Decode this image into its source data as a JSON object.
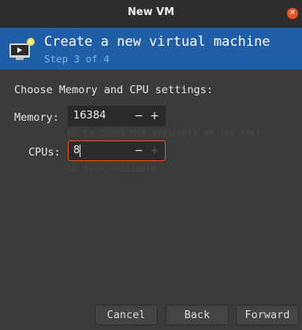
{
  "window": {
    "title": "New VM",
    "close_icon": "close-icon"
  },
  "banner": {
    "heading": "Create a new virtual machine",
    "step": "Step 3 of 4",
    "icon": "vm-icon",
    "color": "#1f5fa8"
  },
  "section_label": "Choose Memory and CPU settings:",
  "memory": {
    "label": "Memory:",
    "value": "16384",
    "minus": "−",
    "plus": "+",
    "hint": "Up to 32000 MiB available on the host"
  },
  "cpus": {
    "label": "CPUs:",
    "value": "8",
    "minus": "−",
    "plus": "+",
    "hint": "Up to 8 available"
  },
  "buttons": {
    "cancel": "Cancel",
    "back": "Back",
    "forward": "Forward"
  },
  "colors": {
    "accent": "#e95420",
    "background": "#3b3b3b"
  }
}
